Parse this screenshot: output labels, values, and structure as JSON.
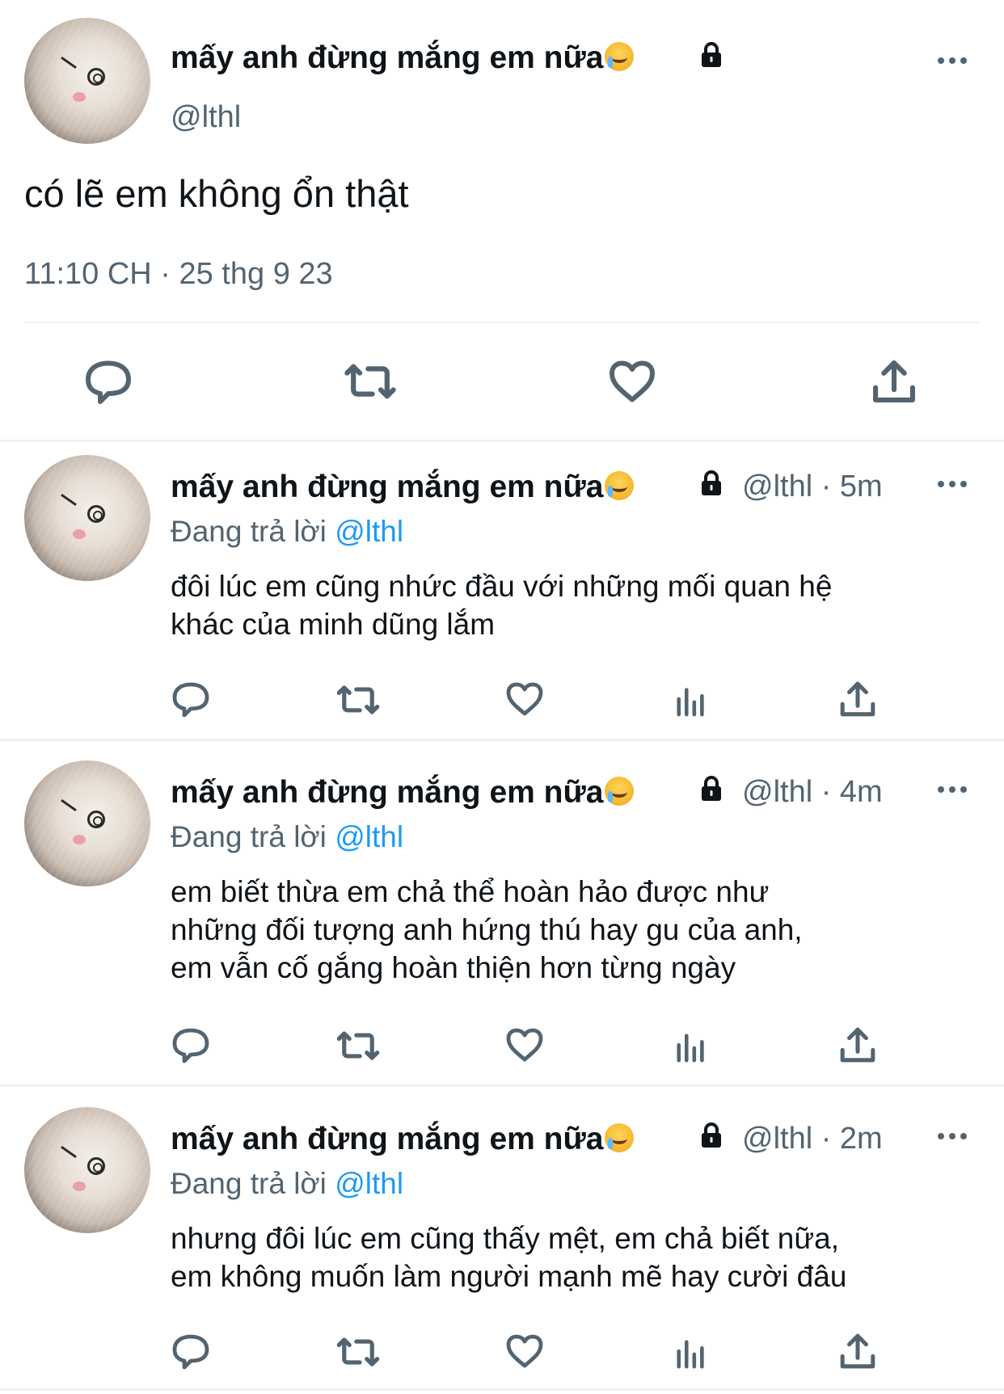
{
  "main_tweet": {
    "display_name": "mấy anh đừng mắng em nữa",
    "handle": "@lthl",
    "text": "có lẽ em không ổn thật",
    "timestamp": "11:10 CH · 25 thg 9 23"
  },
  "replies": [
    {
      "display_name": "mấy anh đừng mắng em nữa",
      "handle_time": "@lthl · 5m",
      "reply_prefix": "Đang trả lời",
      "reply_mention": "@lthl",
      "text_lines": [
        "đôi lúc em cũng nhức đầu với những mối quan hệ",
        "khác của minh dũng lắm"
      ]
    },
    {
      "display_name": "mấy anh đừng mắng em nữa",
      "handle_time": "@lthl · 4m",
      "reply_prefix": "Đang trả lời",
      "reply_mention": "@lthl",
      "text_lines": [
        "em biết thừa em chả thể hoàn hảo được như",
        "những đối tượng anh hứng thú hay gu của anh,",
        "em vẫn cố gắng hoàn thiện hơn từng ngày"
      ]
    },
    {
      "display_name": "mấy anh đừng mắng em nữa",
      "handle_time": "@lthl · 2m",
      "reply_prefix": "Đang trả lời",
      "reply_mention": "@lthl",
      "text_lines": [
        "nhưng đôi lúc em cũng thấy mệt, em chả biết nữa,",
        "em không muốn làm người mạnh mẽ hay cười đâu"
      ]
    }
  ],
  "icons": {
    "emoji": "loudly-crying-face-emoji",
    "protected": "lock-icon",
    "more": "more-dots-icon",
    "actions": [
      "reply-icon",
      "retweet-icon",
      "like-icon",
      "views-icon",
      "share-icon"
    ]
  },
  "colors": {
    "text": "#0f1419",
    "secondary": "#536471",
    "link": "#1d9bf0",
    "divider": "#eff3f4"
  }
}
